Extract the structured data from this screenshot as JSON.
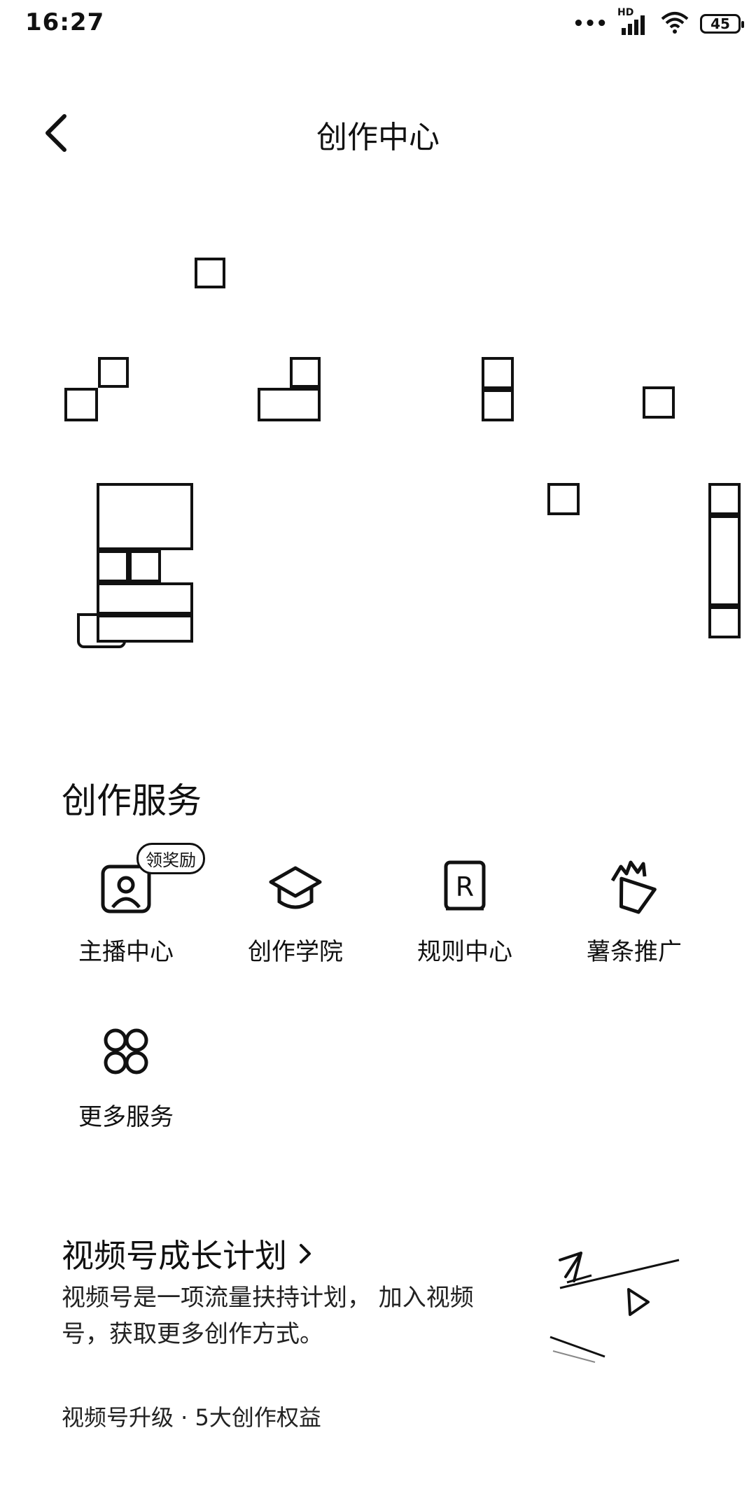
{
  "status_bar": {
    "time": "16:27",
    "network": "HD",
    "battery": "45"
  },
  "header": {
    "back_icon": "chevron-left-icon",
    "title": "创作中心"
  },
  "services": {
    "title": "创作服务",
    "items": [
      {
        "label": "主播中心",
        "icon": "anchor-center-icon",
        "badge": "领奖励"
      },
      {
        "label": "创作学院",
        "icon": "graduation-cap-icon"
      },
      {
        "label": "规则中心",
        "icon": "rule-book-icon"
      },
      {
        "label": "薯条推广",
        "icon": "fries-icon"
      },
      {
        "label": "更多服务",
        "icon": "more-services-icon"
      }
    ]
  },
  "promo_card": {
    "title": "视频号成长计划",
    "description": "视频号是一项流量扶持计划， 加入视频号，获取更多创作方式。",
    "footer": "视频号升级 · 5大创作权益",
    "illustration": "video-growth-illustration"
  }
}
